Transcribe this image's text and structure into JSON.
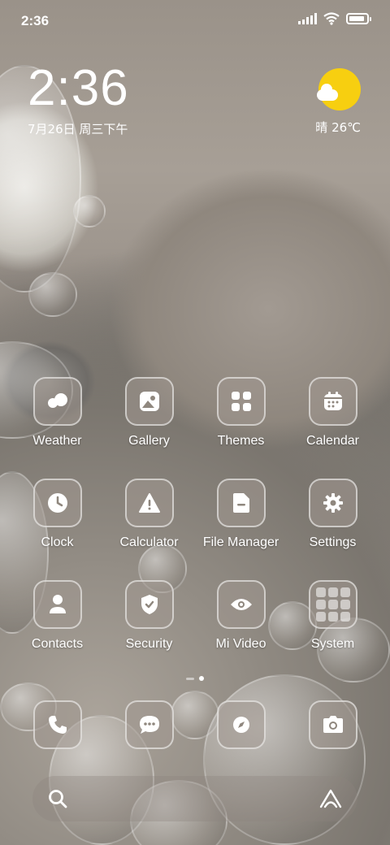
{
  "status_bar": {
    "time": "2:36",
    "battery_percent": 90
  },
  "clock_widget": {
    "time": "2:36",
    "date": "7月26日 周三下午"
  },
  "weather_widget": {
    "summary": "晴 26℃",
    "icon": "sunny-partly-cloudy-icon"
  },
  "apps": [
    {
      "label": "Weather",
      "icon": "weather-icon"
    },
    {
      "label": "Gallery",
      "icon": "gallery-icon"
    },
    {
      "label": "Themes",
      "icon": "themes-icon"
    },
    {
      "label": "Calendar",
      "icon": "calendar-icon"
    },
    {
      "label": "Clock",
      "icon": "clock-icon"
    },
    {
      "label": "Calculator",
      "icon": "calculator-icon"
    },
    {
      "label": "File Manager",
      "icon": "file-manager-icon"
    },
    {
      "label": "Settings",
      "icon": "settings-icon"
    },
    {
      "label": "Contacts",
      "icon": "contacts-icon"
    },
    {
      "label": "Security",
      "icon": "security-icon"
    },
    {
      "label": "Mi Video",
      "icon": "mi-video-icon"
    },
    {
      "label": "System",
      "icon": "system-folder-icon"
    }
  ],
  "dock": [
    {
      "icon": "phone-icon"
    },
    {
      "icon": "messaging-icon"
    },
    {
      "icon": "browser-compass-icon"
    },
    {
      "icon": "camera-icon"
    }
  ],
  "search": {
    "left_icon": "search-icon",
    "right_icon": "assistant-icon"
  },
  "colors": {
    "sun": "#f7cf10",
    "icon_tile": "rgba(160,152,143,0.55)"
  }
}
